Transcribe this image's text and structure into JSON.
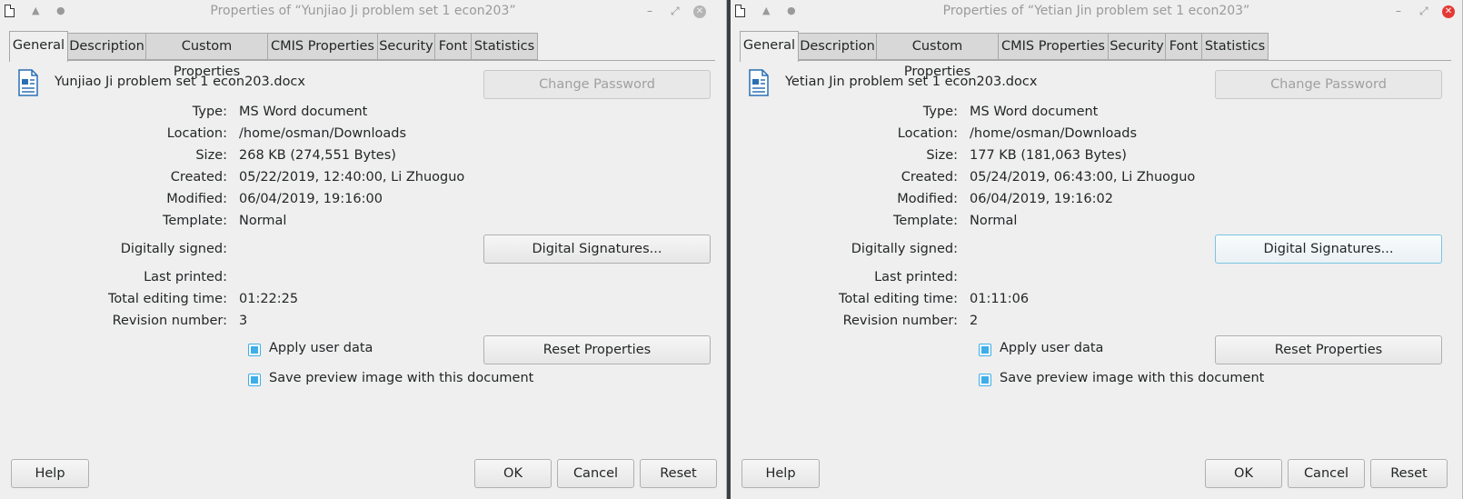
{
  "tabs": [
    "General",
    "Description",
    "Custom Properties",
    "CMIS Properties",
    "Security",
    "Font",
    "Statistics"
  ],
  "labels": {
    "type": "Type:",
    "location": "Location:",
    "size": "Size:",
    "created": "Created:",
    "modified": "Modified:",
    "template": "Template:",
    "digitally_signed": "Digitally signed:",
    "last_printed": "Last printed:",
    "total_editing_time": "Total editing time:",
    "revision_number": "Revision number:"
  },
  "buttons": {
    "change_password": "Change Password",
    "digital_signatures": "Digital Signatures...",
    "reset_properties": "Reset Properties",
    "help": "Help",
    "ok": "OK",
    "cancel": "Cancel",
    "reset": "Reset"
  },
  "checkboxes": {
    "apply_user_data": "Apply user data",
    "save_preview": "Save preview image with this document"
  },
  "dialogs": [
    {
      "title": "Properties of “Yunjiao Ji problem set 1 econ203”",
      "file_name": "Yunjiao Ji problem set 1 econ203.docx",
      "type": "MS Word document",
      "location": "/home/osman/Downloads",
      "size": "268 KB (274,551 Bytes)",
      "created": "05/22/2019, 12:40:00, Li Zhuoguo",
      "modified": "06/04/2019, 19:16:00",
      "template": "Normal",
      "last_printed": "",
      "total_editing_time": "01:22:25",
      "revision_number": "3",
      "apply_user_data": true,
      "save_preview": true
    },
    {
      "title": "Properties of “Yetian Jin problem set 1 econ203”",
      "file_name": "Yetian Jin problem set 1 econ203.docx",
      "type": "MS Word document",
      "location": "/home/osman/Downloads",
      "size": "177 KB (181,063 Bytes)",
      "created": "05/24/2019, 06:43:00, Li Zhuoguo",
      "modified": "06/04/2019, 19:16:02",
      "template": "Normal",
      "last_printed": "",
      "total_editing_time": "01:11:06",
      "revision_number": "2",
      "apply_user_data": true,
      "save_preview": true
    }
  ],
  "colors": {
    "dialog_bg": "#efefef",
    "accent": "#3daee9",
    "close_active": "#e53935"
  },
  "icons": {
    "document_file": "writer-document-icon",
    "window_menu": "window-document-icon",
    "keep_above": "keep-above-icon",
    "on_all_desktops": "on-all-desktops-icon",
    "minimize": "minimize-icon",
    "maximize": "maximize-icon",
    "close": "close-icon"
  }
}
